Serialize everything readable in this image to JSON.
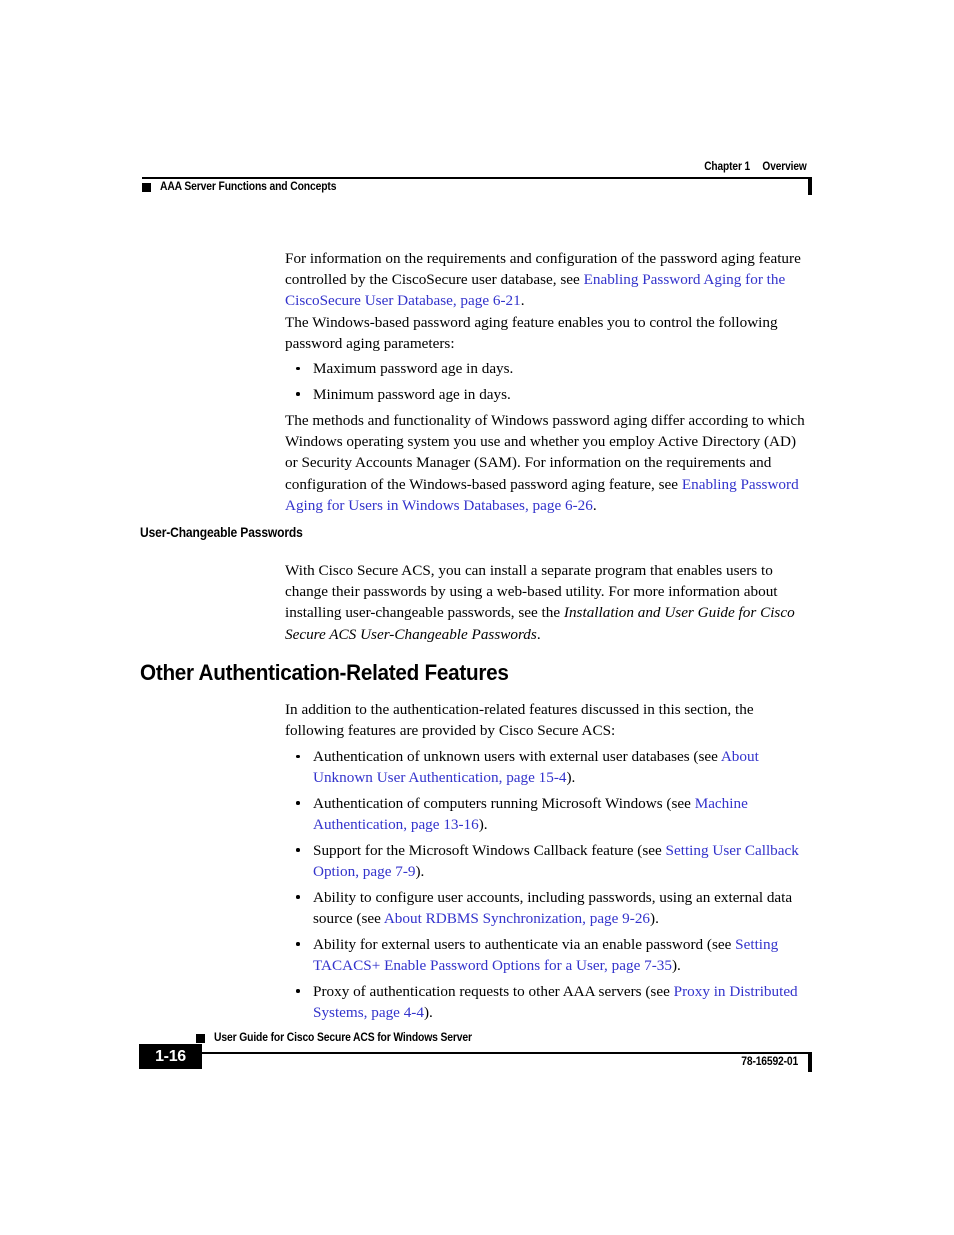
{
  "header": {
    "chapter_label": "Chapter 1",
    "chapter_title": "Overview",
    "running_head": "AAA Server Functions and Concepts"
  },
  "colors": {
    "link": "#3333CC",
    "text": "#000000",
    "background": "#FFFFFF"
  },
  "body": {
    "para_1_pre": "For information on the requirements and configuration of the password aging feature controlled by the CiscoSecure user database, see ",
    "para_1_link": "Enabling Password Aging for the CiscoSecure User Database, page 6-21",
    "para_1_post": ".",
    "para_2": "The Windows-based password aging feature enables you to control the following password aging parameters:",
    "list_1": [
      "Maximum password age in days.",
      "Minimum password age in days."
    ],
    "para_3_pre": "The methods and functionality of Windows password aging differ according to which Windows operating system you use and whether you employ Active Directory (AD) or Security Accounts Manager (SAM). For information on the requirements and configuration of the Windows-based password aging feature, see ",
    "para_3_link": "Enabling Password Aging for Users in Windows Databases, page 6-26",
    "para_3_post": "."
  },
  "section_ucp": {
    "heading": "User-Changeable Passwords",
    "para_pre": "With Cisco Secure ACS, you can install a separate program that enables users to change their passwords by using a web-based utility. For more information about installing user-changeable passwords, see the ",
    "para_italic": "Installation and User Guide for Cisco Secure ACS User-Changeable Passwords",
    "para_post": "."
  },
  "section_other": {
    "heading": "Other Authentication-Related Features",
    "intro": "In addition to the authentication-related features discussed in this section, the following features are provided by Cisco Secure ACS:",
    "items": [
      {
        "pre": "Authentication of unknown users with external user databases (see ",
        "link": "About Unknown User Authentication, page 15-4",
        "post": ")."
      },
      {
        "pre": "Authentication of computers running Microsoft Windows (see ",
        "link": "Machine Authentication, page 13-16",
        "post": ")."
      },
      {
        "pre": "Support for the Microsoft Windows Callback feature (see ",
        "link": "Setting User Callback Option, page 7-9",
        "post": ")."
      },
      {
        "pre": "Ability to configure user accounts, including passwords, using an external data source (see ",
        "link": "About RDBMS Synchronization, page 9-26",
        "post": ")."
      },
      {
        "pre": "Ability for external users to authenticate via an enable password (see ",
        "link": "Setting TACACS+ Enable Password Options for a User, page 7-35",
        "post": ")."
      },
      {
        "pre": "Proxy of authentication requests to other AAA servers (see ",
        "link": "Proxy in Distributed Systems, page 4-4",
        "post": ")."
      }
    ]
  },
  "footer": {
    "guide_title": "User Guide for Cisco Secure ACS for Windows Server",
    "page_number": "1-16",
    "doc_number": "78-16592-01"
  }
}
